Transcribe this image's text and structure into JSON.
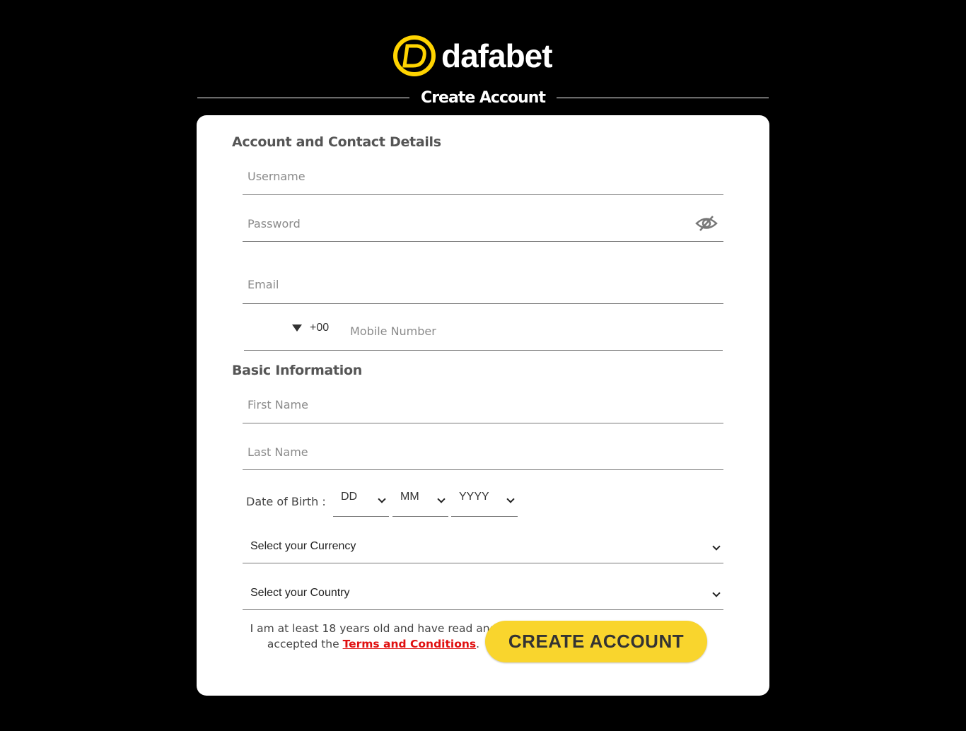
{
  "brand": {
    "name": "dafabet",
    "accent": "#f9d52d",
    "logo_color": "#ffd400"
  },
  "page": {
    "title": "Create Account"
  },
  "account_section": {
    "title": "Account and Contact Details",
    "username_placeholder": "Username",
    "password_placeholder": "Password",
    "email_placeholder": "Email",
    "phone_code": "+00",
    "mobile_placeholder": "Mobile Number"
  },
  "basic_section": {
    "title": "Basic Information",
    "first_name_placeholder": "First Name",
    "last_name_placeholder": "Last Name",
    "dob_label": "Date of Birth :",
    "dob_day": "DD",
    "dob_month": "MM",
    "dob_year": "YYYY",
    "currency_select": "Select your Currency",
    "country_select": "Select your Country"
  },
  "terms": {
    "text_before": "I am at least 18 years old and have read and accepted the ",
    "link": "Terms and Conditions",
    "text_after": "."
  },
  "submit_label": "CREATE ACCOUNT",
  "icons": {
    "password_toggle": "eye-slash-icon",
    "phone_dropdown": "caret-down-icon"
  }
}
